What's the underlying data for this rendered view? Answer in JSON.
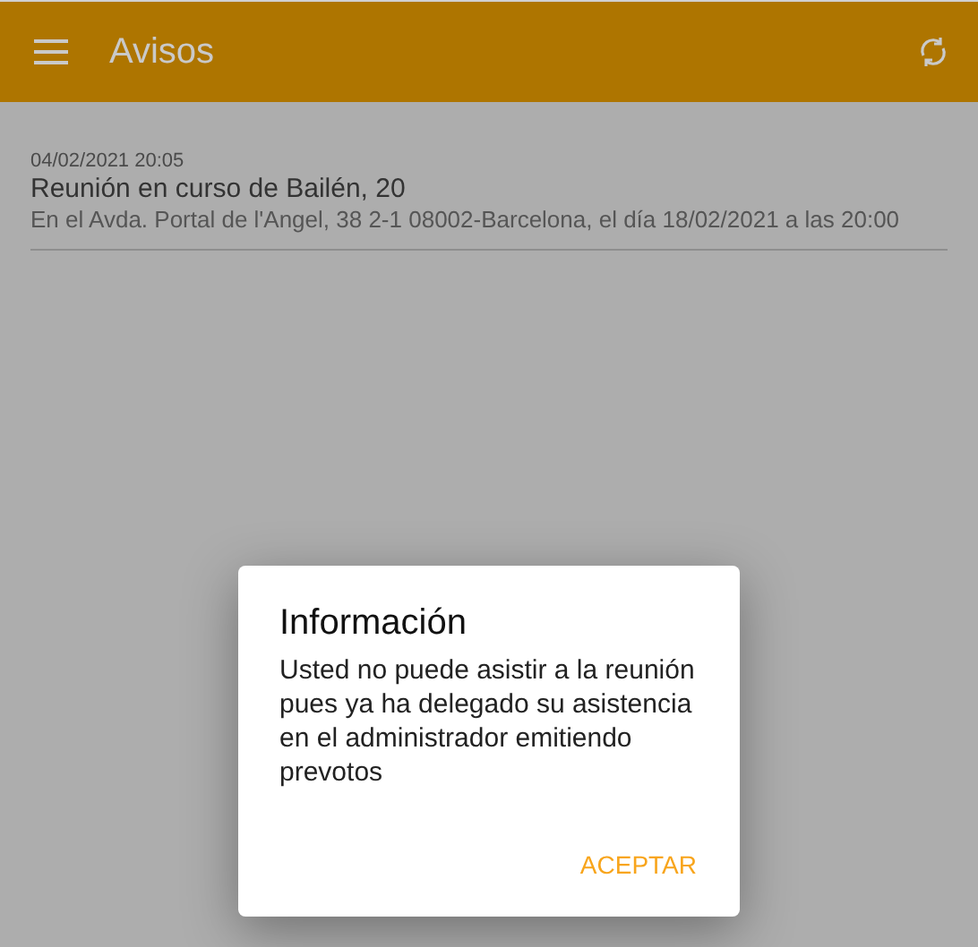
{
  "app_bar": {
    "title": "Avisos"
  },
  "notices": [
    {
      "date": "04/02/2021 20:05",
      "title": "Reunión en curso de Bailén, 20",
      "detail": "En el Avda. Portal de l'Angel, 38 2-1 08002-Barcelona, el día 18/02/2021 a las 20:00"
    }
  ],
  "dialog": {
    "title": "Información",
    "message": "Usted no puede asistir a la reunión pues ya ha delegado su asistencia en el administrador emitiendo prevotos",
    "button": "ACEPTAR"
  }
}
